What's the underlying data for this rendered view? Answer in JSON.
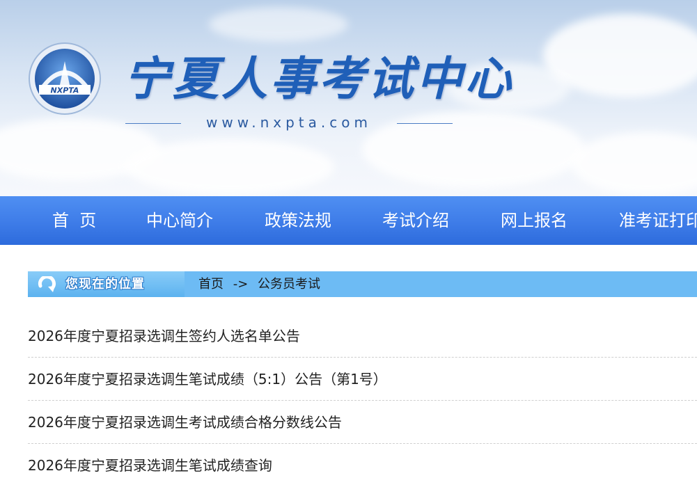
{
  "header": {
    "logo_emblem_text": "NXPTA",
    "site_title": "宁夏人事考试中心",
    "site_url": "www.nxpta.com"
  },
  "nav": {
    "items": [
      {
        "label": "首  页"
      },
      {
        "label": "中心简介"
      },
      {
        "label": "政策法规"
      },
      {
        "label": "考试介绍"
      },
      {
        "label": "网上报名"
      },
      {
        "label": "准考证打印"
      }
    ]
  },
  "breadcrumb": {
    "badge_label": "您现在的位置",
    "home": "首页",
    "separator": "->",
    "current": "公务员考试"
  },
  "articles": [
    {
      "title": "2026年度宁夏招录选调生签约人选名单公告"
    },
    {
      "title": "2026年度宁夏招录选调生笔试成绩（5:1）公告（第1号）"
    },
    {
      "title": "2026年度宁夏招录选调生考试成绩合格分数线公告"
    },
    {
      "title": "2026年度宁夏招录选调生笔试成绩查询"
    }
  ],
  "colors": {
    "nav_bg": "#3e7ce8",
    "breadcrumb_bg": "#6dbbf4",
    "title_blue": "#1f5fb8"
  }
}
